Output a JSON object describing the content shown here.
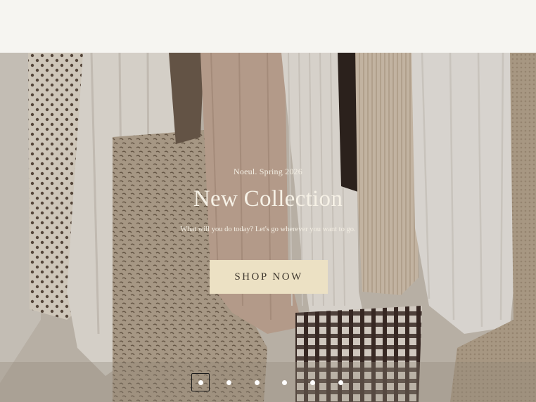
{
  "hero": {
    "eyebrow": "Noeul. Spring 2026",
    "headline": "New Collection",
    "subline": "What will you do today? Let's go wherever you want to go.",
    "cta_label": "SHOP NOW",
    "image_subject": "clothes-on-rack"
  },
  "slider": {
    "total_slides": 6,
    "active_index": 0
  },
  "colors": {
    "page_bg": "#f6f5f1",
    "cta_bg": "#ece1c4",
    "cta_text": "#3c352c",
    "hero_text": "#f6f1e6"
  }
}
